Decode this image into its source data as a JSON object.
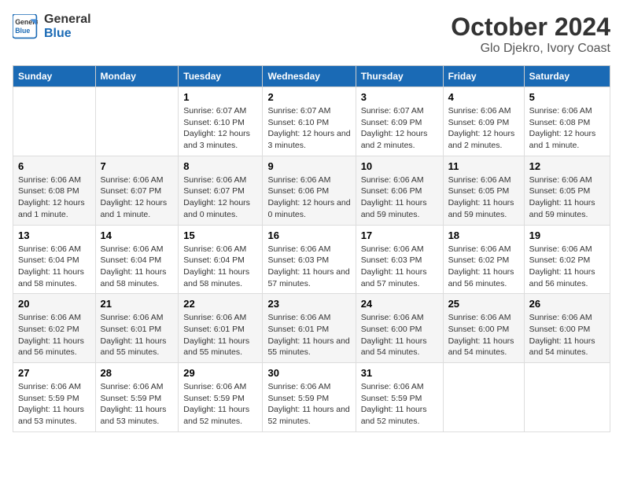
{
  "header": {
    "logo_line1": "General",
    "logo_line2": "Blue",
    "title": "October 2024",
    "subtitle": "Glo Djekro, Ivory Coast"
  },
  "calendar": {
    "days_of_week": [
      "Sunday",
      "Monday",
      "Tuesday",
      "Wednesday",
      "Thursday",
      "Friday",
      "Saturday"
    ],
    "weeks": [
      [
        {
          "day": "",
          "info": ""
        },
        {
          "day": "",
          "info": ""
        },
        {
          "day": "1",
          "info": "Sunrise: 6:07 AM\nSunset: 6:10 PM\nDaylight: 12 hours and 3 minutes."
        },
        {
          "day": "2",
          "info": "Sunrise: 6:07 AM\nSunset: 6:10 PM\nDaylight: 12 hours and 3 minutes."
        },
        {
          "day": "3",
          "info": "Sunrise: 6:07 AM\nSunset: 6:09 PM\nDaylight: 12 hours and 2 minutes."
        },
        {
          "day": "4",
          "info": "Sunrise: 6:06 AM\nSunset: 6:09 PM\nDaylight: 12 hours and 2 minutes."
        },
        {
          "day": "5",
          "info": "Sunrise: 6:06 AM\nSunset: 6:08 PM\nDaylight: 12 hours and 1 minute."
        }
      ],
      [
        {
          "day": "6",
          "info": "Sunrise: 6:06 AM\nSunset: 6:08 PM\nDaylight: 12 hours and 1 minute."
        },
        {
          "day": "7",
          "info": "Sunrise: 6:06 AM\nSunset: 6:07 PM\nDaylight: 12 hours and 1 minute."
        },
        {
          "day": "8",
          "info": "Sunrise: 6:06 AM\nSunset: 6:07 PM\nDaylight: 12 hours and 0 minutes."
        },
        {
          "day": "9",
          "info": "Sunrise: 6:06 AM\nSunset: 6:06 PM\nDaylight: 12 hours and 0 minutes."
        },
        {
          "day": "10",
          "info": "Sunrise: 6:06 AM\nSunset: 6:06 PM\nDaylight: 11 hours and 59 minutes."
        },
        {
          "day": "11",
          "info": "Sunrise: 6:06 AM\nSunset: 6:05 PM\nDaylight: 11 hours and 59 minutes."
        },
        {
          "day": "12",
          "info": "Sunrise: 6:06 AM\nSunset: 6:05 PM\nDaylight: 11 hours and 59 minutes."
        }
      ],
      [
        {
          "day": "13",
          "info": "Sunrise: 6:06 AM\nSunset: 6:04 PM\nDaylight: 11 hours and 58 minutes."
        },
        {
          "day": "14",
          "info": "Sunrise: 6:06 AM\nSunset: 6:04 PM\nDaylight: 11 hours and 58 minutes."
        },
        {
          "day": "15",
          "info": "Sunrise: 6:06 AM\nSunset: 6:04 PM\nDaylight: 11 hours and 58 minutes."
        },
        {
          "day": "16",
          "info": "Sunrise: 6:06 AM\nSunset: 6:03 PM\nDaylight: 11 hours and 57 minutes."
        },
        {
          "day": "17",
          "info": "Sunrise: 6:06 AM\nSunset: 6:03 PM\nDaylight: 11 hours and 57 minutes."
        },
        {
          "day": "18",
          "info": "Sunrise: 6:06 AM\nSunset: 6:02 PM\nDaylight: 11 hours and 56 minutes."
        },
        {
          "day": "19",
          "info": "Sunrise: 6:06 AM\nSunset: 6:02 PM\nDaylight: 11 hours and 56 minutes."
        }
      ],
      [
        {
          "day": "20",
          "info": "Sunrise: 6:06 AM\nSunset: 6:02 PM\nDaylight: 11 hours and 56 minutes."
        },
        {
          "day": "21",
          "info": "Sunrise: 6:06 AM\nSunset: 6:01 PM\nDaylight: 11 hours and 55 minutes."
        },
        {
          "day": "22",
          "info": "Sunrise: 6:06 AM\nSunset: 6:01 PM\nDaylight: 11 hours and 55 minutes."
        },
        {
          "day": "23",
          "info": "Sunrise: 6:06 AM\nSunset: 6:01 PM\nDaylight: 11 hours and 55 minutes."
        },
        {
          "day": "24",
          "info": "Sunrise: 6:06 AM\nSunset: 6:00 PM\nDaylight: 11 hours and 54 minutes."
        },
        {
          "day": "25",
          "info": "Sunrise: 6:06 AM\nSunset: 6:00 PM\nDaylight: 11 hours and 54 minutes."
        },
        {
          "day": "26",
          "info": "Sunrise: 6:06 AM\nSunset: 6:00 PM\nDaylight: 11 hours and 54 minutes."
        }
      ],
      [
        {
          "day": "27",
          "info": "Sunrise: 6:06 AM\nSunset: 5:59 PM\nDaylight: 11 hours and 53 minutes."
        },
        {
          "day": "28",
          "info": "Sunrise: 6:06 AM\nSunset: 5:59 PM\nDaylight: 11 hours and 53 minutes."
        },
        {
          "day": "29",
          "info": "Sunrise: 6:06 AM\nSunset: 5:59 PM\nDaylight: 11 hours and 52 minutes."
        },
        {
          "day": "30",
          "info": "Sunrise: 6:06 AM\nSunset: 5:59 PM\nDaylight: 11 hours and 52 minutes."
        },
        {
          "day": "31",
          "info": "Sunrise: 6:06 AM\nSunset: 5:59 PM\nDaylight: 11 hours and 52 minutes."
        },
        {
          "day": "",
          "info": ""
        },
        {
          "day": "",
          "info": ""
        }
      ]
    ]
  }
}
